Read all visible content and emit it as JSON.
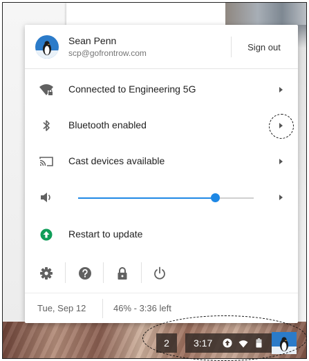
{
  "user": {
    "name": "Sean Penn",
    "email": "scp@gofrontrow.com",
    "sign_out_label": "Sign out",
    "avatar_icon": "penguin-avatar-icon"
  },
  "rows": [
    {
      "label": "Connected to Engineering 5G",
      "icon": "wifi-locked-icon"
    },
    {
      "label": "Bluetooth enabled",
      "icon": "bluetooth-icon"
    },
    {
      "label": "Cast devices available",
      "icon": "cast-icon"
    },
    {
      "label": "Restart to update",
      "icon": "update-icon"
    }
  ],
  "volume": {
    "icon": "volume-icon",
    "level_fraction": 0.78
  },
  "quick_actions": [
    "settings-icon",
    "help-icon",
    "lock-icon",
    "power-icon"
  ],
  "status": {
    "date": "Tue, Sep 12",
    "battery": "46% - 3:36 left"
  },
  "shelf": {
    "notification_count": "2",
    "time": "3:17",
    "icons": [
      "update-icon",
      "wifi-icon",
      "battery-icon"
    ]
  },
  "colors": {
    "accent": "#1e88e5",
    "update_green": "#0f9d58",
    "icon_gray": "#616161"
  }
}
